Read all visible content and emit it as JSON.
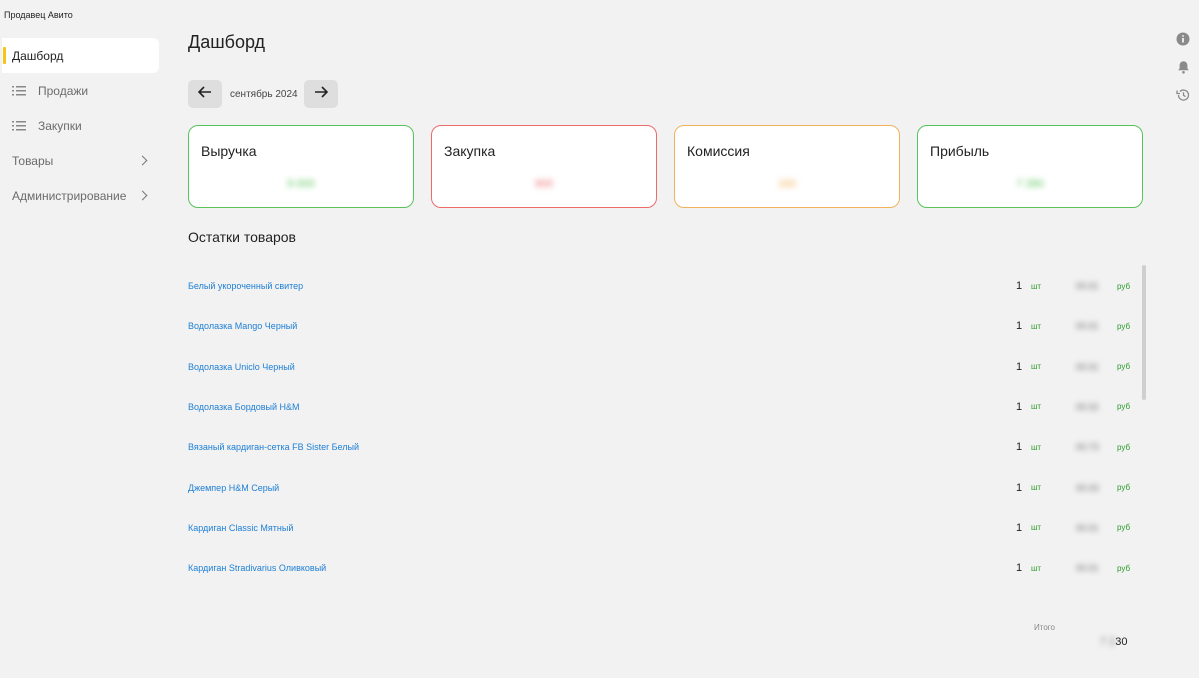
{
  "app": {
    "title": "Продавец Авито"
  },
  "sidebar": {
    "items": [
      {
        "label": "Дашборд",
        "icon": "none"
      },
      {
        "label": "Продажи",
        "icon": "list-icon"
      },
      {
        "label": "Закупки",
        "icon": "list-icon"
      },
      {
        "label": "Товары",
        "icon": "chevron-right-icon"
      },
      {
        "label": "Администрирование",
        "icon": "chevron-right-icon"
      }
    ]
  },
  "header": {
    "title": "Дашборд"
  },
  "month_nav": {
    "label": "сентябрь 2024"
  },
  "cards": [
    {
      "label": "Выручка",
      "value": "9 000",
      "color": "#58c35a"
    },
    {
      "label": "Закупка",
      "value": "900",
      "color": "#ee6b6b"
    },
    {
      "label": "Комиссия",
      "value": "180",
      "color": "#f2b25c"
    },
    {
      "label": "Прибыль",
      "value": "7 280",
      "color": "#58c35a"
    }
  ],
  "stock": {
    "title": "Остатки товаров",
    "rows": [
      {
        "name": "Белый укороченный свитер",
        "qty": "1",
        "unit": "шт",
        "price": "00.01",
        "currency": "руб"
      },
      {
        "name": "Водолазка Mango Черный",
        "qty": "1",
        "unit": "шт",
        "price": "00.01",
        "currency": "руб"
      },
      {
        "name": "Водолазка Uniclo Черный",
        "qty": "1",
        "unit": "шт",
        "price": "00.01",
        "currency": "руб"
      },
      {
        "name": "Водолазка Бордовый H&M",
        "qty": "1",
        "unit": "шт",
        "price": "00.02",
        "currency": "руб"
      },
      {
        "name": "Вязаный кардиган-сетка FB Sister Белый",
        "qty": "1",
        "unit": "шт",
        "price": "00.73",
        "currency": "руб"
      },
      {
        "name": "Джемпер H&M Серый",
        "qty": "1",
        "unit": "шт",
        "price": "00.03",
        "currency": "руб"
      },
      {
        "name": "Кардиган Classic Мятный",
        "qty": "1",
        "unit": "шт",
        "price": "00.01",
        "currency": "руб"
      },
      {
        "name": "Кардиган Stradivarius Оливковый",
        "qty": "1",
        "unit": "шт",
        "price": "00.01",
        "currency": "руб"
      }
    ],
    "total_label": "Итого",
    "total_blurred": "7 2",
    "total_visible": "30"
  },
  "right_icons": [
    "info-icon",
    "bell-icon",
    "history-icon"
  ],
  "colors": {
    "accent": "#f5c518",
    "link": "#1e7fd6",
    "green": "#2a9a2a"
  }
}
